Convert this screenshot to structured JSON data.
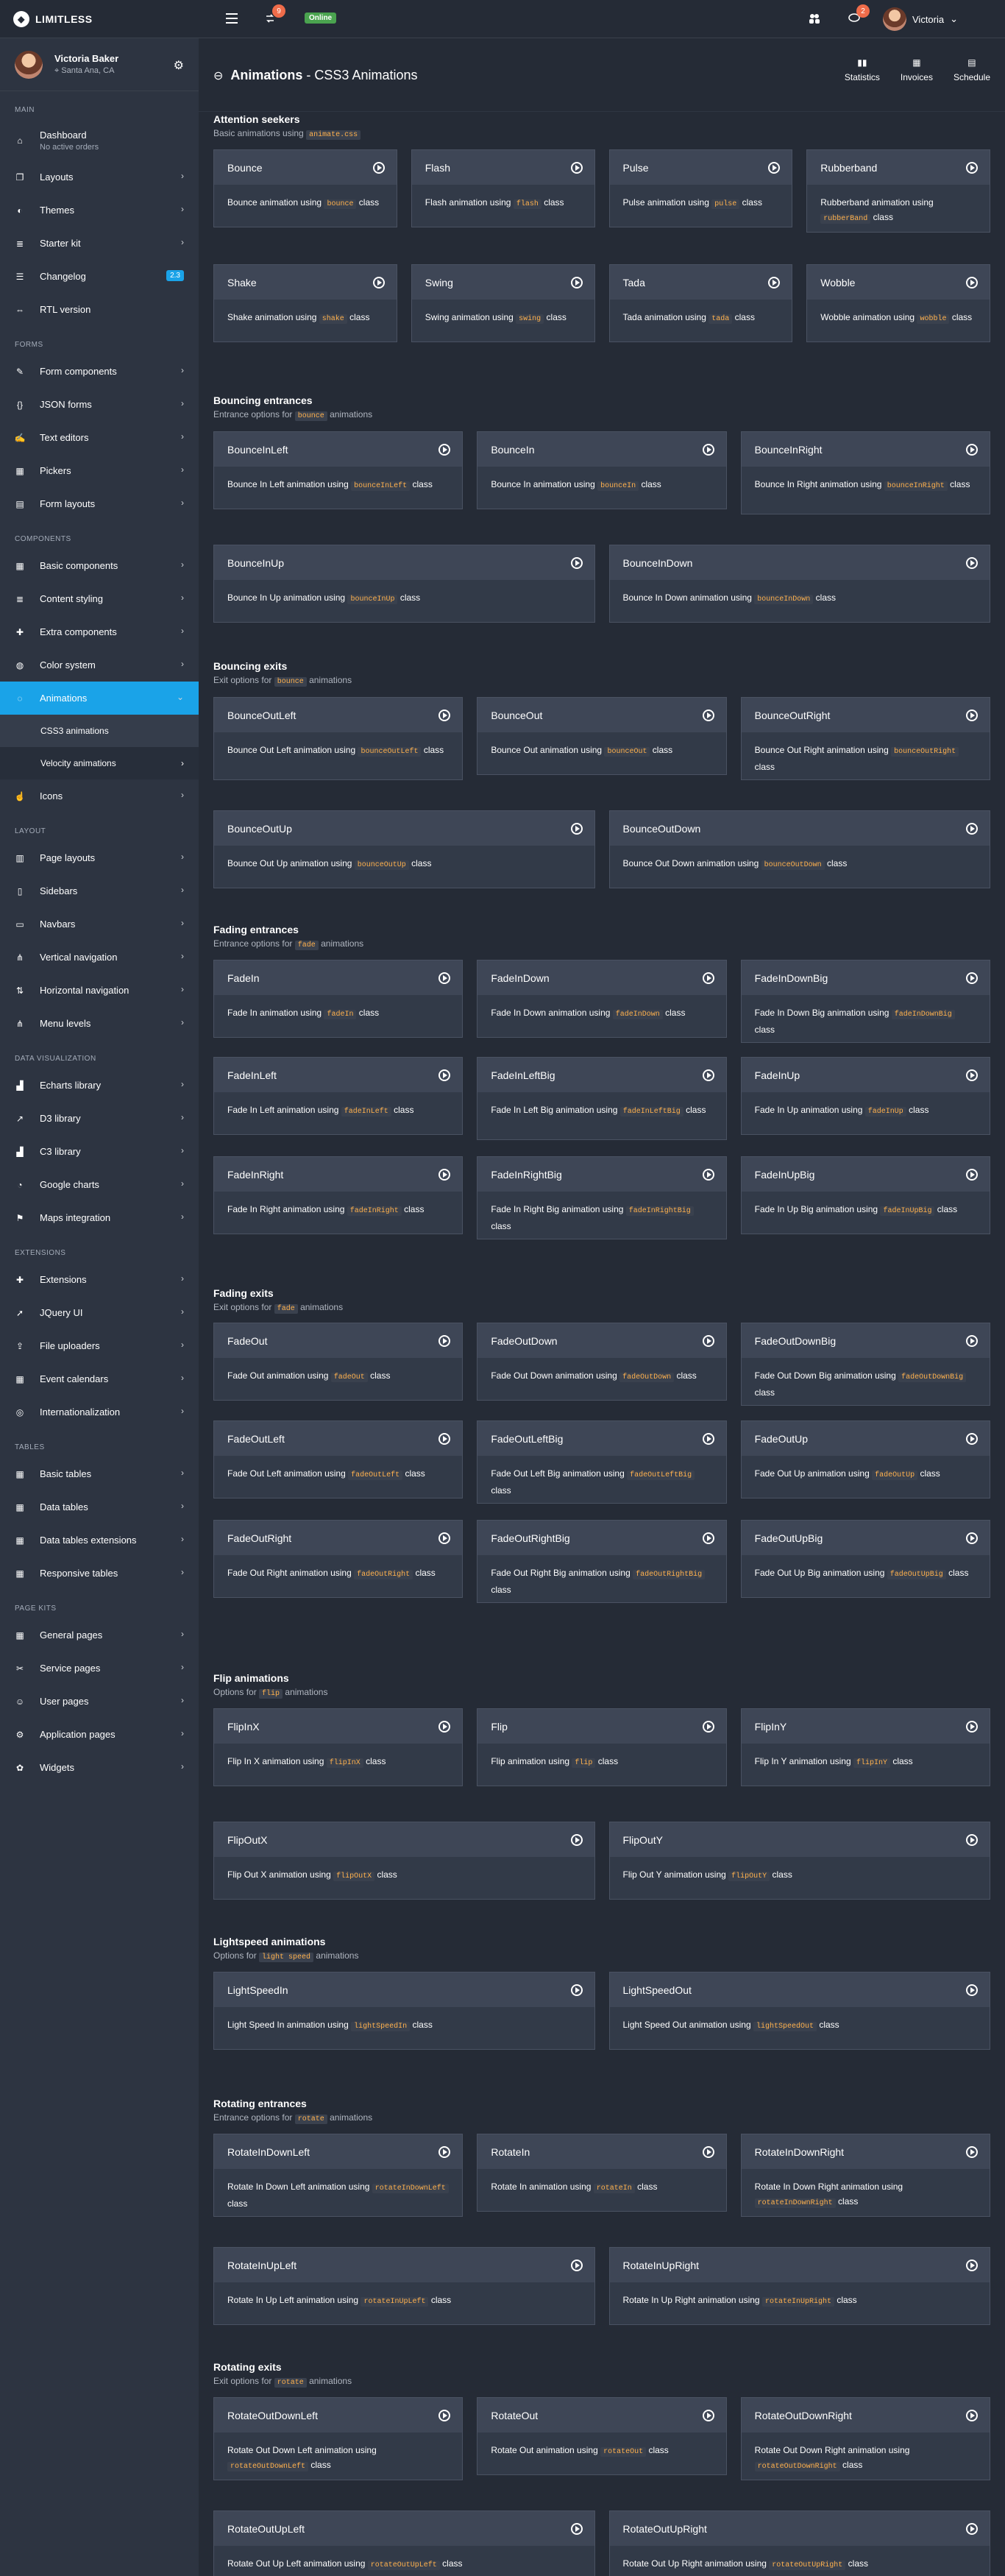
{
  "app": {
    "brand": "LIMITLESS",
    "online_label": "Online",
    "badge_sync": "9",
    "badge_msgs": "2",
    "user_name": "Victoria"
  },
  "sidebar": {
    "user_name": "Victoria Baker",
    "user_location": "Santa Ana, CA",
    "groups": [
      {
        "title": "MAIN",
        "items": [
          {
            "label": "Dashboard",
            "desc": "No active orders",
            "icon": "home-icon"
          },
          {
            "label": "Layouts",
            "icon": "copy-icon",
            "chev": true
          },
          {
            "label": "Themes",
            "icon": "palette-icon",
            "chev": true
          },
          {
            "label": "Starter kit",
            "icon": "stack-icon",
            "chev": true
          },
          {
            "label": "Changelog",
            "icon": "list-icon",
            "badge": "2.3"
          },
          {
            "label": "RTL version",
            "icon": "width-icon"
          }
        ]
      },
      {
        "title": "FORMS",
        "items": [
          {
            "label": "Form components",
            "icon": "pencil-icon",
            "chev": true
          },
          {
            "label": "JSON forms",
            "icon": "braces-icon",
            "chev": true
          },
          {
            "label": "Text editors",
            "icon": "edit-icon",
            "chev": true
          },
          {
            "label": "Pickers",
            "icon": "calendar-icon",
            "chev": true
          },
          {
            "label": "Form layouts",
            "icon": "form-icon",
            "chev": true
          }
        ]
      },
      {
        "title": "COMPONENTS",
        "items": [
          {
            "label": "Basic components",
            "icon": "grid-icon",
            "chev": true
          },
          {
            "label": "Content styling",
            "icon": "stack-icon",
            "chev": true
          },
          {
            "label": "Extra components",
            "icon": "puzzle-icon",
            "chev": true
          },
          {
            "label": "Color system",
            "icon": "drop-icon",
            "chev": true
          },
          {
            "label": "Animations",
            "icon": "spinner-icon",
            "chev": true,
            "active": true,
            "subs": [
              "CSS3 animations",
              "Velocity animations"
            ]
          },
          {
            "label": "Icons",
            "icon": "thumbs-up-icon",
            "chev": true
          }
        ]
      },
      {
        "title": "LAYOUT",
        "items": [
          {
            "label": "Page layouts",
            "icon": "layout-icon",
            "chev": true
          },
          {
            "label": "Sidebars",
            "icon": "sidebar-icon",
            "chev": true
          },
          {
            "label": "Navbars",
            "icon": "navbar-icon",
            "chev": true
          },
          {
            "label": "Vertical navigation",
            "icon": "tree-icon",
            "chev": true
          },
          {
            "label": "Horizontal navigation",
            "icon": "sort-icon",
            "chev": true
          },
          {
            "label": "Menu levels",
            "icon": "tree-icon",
            "chev": true
          }
        ]
      },
      {
        "title": "DATA VISUALIZATION",
        "items": [
          {
            "label": "Echarts library",
            "icon": "chart-icon",
            "chev": true
          },
          {
            "label": "D3 library",
            "icon": "chart-line-icon",
            "chev": true
          },
          {
            "label": "C3 library",
            "icon": "chart-icon",
            "chev": true
          },
          {
            "label": "Google charts",
            "icon": "pie-icon",
            "chev": true
          },
          {
            "label": "Maps integration",
            "icon": "map-icon",
            "chev": true
          }
        ]
      },
      {
        "title": "EXTENSIONS",
        "items": [
          {
            "label": "Extensions",
            "icon": "puzzle-icon",
            "chev": true
          },
          {
            "label": "JQuery UI",
            "icon": "cursor-icon",
            "chev": true
          },
          {
            "label": "File uploaders",
            "icon": "upload-icon",
            "chev": true
          },
          {
            "label": "Event calendars",
            "icon": "calendar-icon",
            "chev": true
          },
          {
            "label": "Internationalization",
            "icon": "globe-icon",
            "chev": true
          }
        ]
      },
      {
        "title": "TABLES",
        "items": [
          {
            "label": "Basic tables",
            "icon": "table-icon",
            "chev": true
          },
          {
            "label": "Data tables",
            "icon": "table-icon",
            "chev": true
          },
          {
            "label": "Data tables extensions",
            "icon": "table-icon",
            "chev": true
          },
          {
            "label": "Responsive tables",
            "icon": "table-icon",
            "chev": true
          }
        ]
      },
      {
        "title": "PAGE KITS",
        "items": [
          {
            "label": "General pages",
            "icon": "grid-icon",
            "chev": true
          },
          {
            "label": "Service pages",
            "icon": "tools-icon",
            "chev": true
          },
          {
            "label": "User pages",
            "icon": "users-icon",
            "chev": true
          },
          {
            "label": "Application pages",
            "icon": "gear-icon",
            "chev": true
          },
          {
            "label": "Widgets",
            "icon": "widget-icon",
            "chev": true
          }
        ]
      }
    ]
  },
  "header": {
    "title_bold": "Animations",
    "title_rest": " - CSS3 Animations",
    "buttons": [
      "Statistics",
      "Invoices",
      "Schedule"
    ]
  },
  "sections": [
    {
      "title": "Attention seekers",
      "sub_pre": "Basic animations using",
      "sub_code": "animate.css",
      "sub_post": "",
      "cols": 4,
      "rows": [
        [
          {
            "name": "Bounce",
            "pre": "Bounce animation using",
            "code": "bounce",
            "post": "class"
          },
          {
            "name": "Flash",
            "pre": "Flash animation using",
            "code": "flash",
            "post": "class"
          },
          {
            "name": "Pulse",
            "pre": "Pulse animation using",
            "code": "pulse",
            "post": "class"
          },
          {
            "name": "Rubberband",
            "pre": "Rubberband animation using",
            "code": "rubberBand",
            "post": "class"
          }
        ],
        [
          {
            "name": "Shake",
            "pre": "Shake animation using",
            "code": "shake",
            "post": "class"
          },
          {
            "name": "Swing",
            "pre": "Swing animation using",
            "code": "swing",
            "post": "class"
          },
          {
            "name": "Tada",
            "pre": "Tada animation using",
            "code": "tada",
            "post": "class"
          },
          {
            "name": "Wobble",
            "pre": "Wobble animation using",
            "code": "wobble",
            "post": "class"
          }
        ]
      ]
    },
    {
      "title": "Bouncing entrances",
      "sub_pre": "Entrance options for",
      "sub_code": "bounce",
      "sub_post": "animations",
      "cols": 3,
      "rows": [
        [
          {
            "name": "BounceInLeft",
            "pre": "Bounce In Left animation using",
            "code": "bounceInLeft",
            "post": "class"
          },
          {
            "name": "BounceIn",
            "pre": "Bounce In animation using",
            "code": "bounceIn",
            "post": "class"
          },
          {
            "name": "BounceInRight",
            "pre": "Bounce In Right animation using",
            "code": "bounceInRight",
            "post": "class"
          }
        ],
        [
          {
            "name": "BounceInUp",
            "pre": "Bounce In Up animation using",
            "code": "bounceInUp",
            "post": "class"
          },
          {
            "name": "BounceInDown",
            "pre": "Bounce In Down animation using",
            "code": "bounceInDown",
            "post": "class"
          }
        ]
      ]
    },
    {
      "title": "Bouncing exits",
      "sub_pre": "Exit options for",
      "sub_code": "bounce",
      "sub_post": "animations",
      "cols": 3,
      "rows": [
        [
          {
            "name": "BounceOutLeft",
            "pre": "Bounce Out Left animation using",
            "code": "bounceOutLeft",
            "post": "class"
          },
          {
            "name": "BounceOut",
            "pre": "Bounce Out animation using",
            "code": "bounceOut",
            "post": "class"
          },
          {
            "name": "BounceOutRight",
            "pre": "Bounce Out Right animation using",
            "code": "bounceOutRight",
            "post": "class"
          }
        ],
        [
          {
            "name": "BounceOutUp",
            "pre": "Bounce Out Up animation using",
            "code": "bounceOutUp",
            "post": "class"
          },
          {
            "name": "BounceOutDown",
            "pre": "Bounce Out Down animation using",
            "code": "bounceOutDown",
            "post": "class"
          }
        ]
      ]
    },
    {
      "title": "Fading entrances",
      "sub_pre": "Entrance options for",
      "sub_code": "fade",
      "sub_post": "animations",
      "cols": 3,
      "rows": [
        [
          {
            "name": "FadeIn",
            "pre": "Fade In animation using",
            "code": "fadeIn",
            "post": "class"
          },
          {
            "name": "FadeInDown",
            "pre": "Fade In Down animation using",
            "code": "fadeInDown",
            "post": "class"
          },
          {
            "name": "FadeInDownBig",
            "pre": "Fade In Down Big animation using",
            "code": "fadeInDownBig",
            "post": "class"
          }
        ],
        [
          {
            "name": "FadeInLeft",
            "pre": "Fade In Left animation using",
            "code": "fadeInLeft",
            "post": "class"
          },
          {
            "name": "FadeInLeftBig",
            "pre": "Fade In Left Big animation using",
            "code": "fadeInLeftBig",
            "post": "class"
          },
          {
            "name": "FadeInUp",
            "pre": "Fade In Up animation using",
            "code": "fadeInUp",
            "post": "class"
          }
        ],
        [
          {
            "name": "FadeInRight",
            "pre": "Fade In Right animation using",
            "code": "fadeInRight",
            "post": "class"
          },
          {
            "name": "FadeInRightBig",
            "pre": "Fade In Right Big animation using",
            "code": "fadeInRightBig",
            "post": "class"
          },
          {
            "name": "FadeInUpBig",
            "pre": "Fade In Up Big animation using",
            "code": "fadeInUpBig",
            "post": "class"
          }
        ]
      ]
    },
    {
      "title": "Fading exits",
      "sub_pre": "Exit options for",
      "sub_code": "fade",
      "sub_post": "animations",
      "cols": 3,
      "rows": [
        [
          {
            "name": "FadeOut",
            "pre": "Fade Out animation using",
            "code": "fadeOut",
            "post": "class"
          },
          {
            "name": "FadeOutDown",
            "pre": "Fade Out Down animation using",
            "code": "fadeOutDown",
            "post": "class"
          },
          {
            "name": "FadeOutDownBig",
            "pre": "Fade Out Down Big animation using",
            "code": "fadeOutDownBig",
            "post": "class"
          }
        ],
        [
          {
            "name": "FadeOutLeft",
            "pre": "Fade Out Left animation using",
            "code": "fadeOutLeft",
            "post": "class"
          },
          {
            "name": "FadeOutLeftBig",
            "pre": "Fade Out Left Big animation using",
            "code": "fadeOutLeftBig",
            "post": "class"
          },
          {
            "name": "FadeOutUp",
            "pre": "Fade Out Up animation using",
            "code": "fadeOutUp",
            "post": "class"
          }
        ],
        [
          {
            "name": "FadeOutRight",
            "pre": "Fade Out Right animation using",
            "code": "fadeOutRight",
            "post": "class"
          },
          {
            "name": "FadeOutRightBig",
            "pre": "Fade Out Right Big animation using",
            "code": "fadeOutRightBig",
            "post": "class"
          },
          {
            "name": "FadeOutUpBig",
            "pre": "Fade Out Up Big animation using",
            "code": "fadeOutUpBig",
            "post": "class"
          }
        ]
      ]
    },
    {
      "title": "Flip animations",
      "sub_pre": "Options for",
      "sub_code": "flip",
      "sub_post": "animations",
      "cols": 3,
      "rows": [
        [
          {
            "name": "FlipInX",
            "pre": "Flip In X animation using",
            "code": "flipInX",
            "post": "class"
          },
          {
            "name": "Flip",
            "pre": "Flip animation using",
            "code": "flip",
            "post": "class"
          },
          {
            "name": "FlipInY",
            "pre": "Flip In Y animation using",
            "code": "flipInY",
            "post": "class"
          }
        ],
        [
          {
            "name": "FlipOutX",
            "pre": "Flip Out X animation using",
            "code": "flipOutX",
            "post": "class"
          },
          {
            "name": "FlipOutY",
            "pre": "Flip Out Y animation using",
            "code": "flipOutY",
            "post": "class"
          }
        ]
      ]
    },
    {
      "title": "Lightspeed animations",
      "sub_pre": "Options for",
      "sub_code": "light speed",
      "sub_post": "animations",
      "cols": 2,
      "rows": [
        [
          {
            "name": "LightSpeedIn",
            "pre": "Light Speed In animation using",
            "code": "lightSpeedIn",
            "post": "class"
          },
          {
            "name": "LightSpeedOut",
            "pre": "Light Speed Out animation using",
            "code": "lightSpeedOut",
            "post": "class"
          }
        ]
      ]
    },
    {
      "title": "Rotating entrances",
      "sub_pre": "Entrance options for",
      "sub_code": "rotate",
      "sub_post": "animations",
      "cols": 3,
      "rows": [
        [
          {
            "name": "RotateInDownLeft",
            "pre": "Rotate In Down Left animation using",
            "code": "rotateInDownLeft",
            "post": "class"
          },
          {
            "name": "RotateIn",
            "pre": "Rotate In animation using",
            "code": "rotateIn",
            "post": "class"
          },
          {
            "name": "RotateInDownRight",
            "pre": "Rotate In Down Right animation using",
            "code": "rotateInDownRight",
            "post": "class"
          }
        ],
        [
          {
            "name": "RotateInUpLeft",
            "pre": "Rotate In Up Left animation using",
            "code": "rotateInUpLeft",
            "post": "class"
          },
          {
            "name": "RotateInUpRight",
            "pre": "Rotate In Up Right animation using",
            "code": "rotateInUpRight",
            "post": "class"
          }
        ]
      ]
    },
    {
      "title": "Rotating exits",
      "sub_pre": "Exit options for",
      "sub_code": "rotate",
      "sub_post": "animations",
      "cols": 3,
      "rows": [
        [
          {
            "name": "RotateOutDownLeft",
            "pre": "Rotate Out Down Left animation using",
            "code": "rotateOutDownLeft",
            "post": "class"
          },
          {
            "name": "RotateOut",
            "pre": "Rotate Out animation using",
            "code": "rotateOut",
            "post": "class"
          },
          {
            "name": "RotateOutDownRight",
            "pre": "Rotate Out Down Right animation using",
            "code": "rotateOutDownRight",
            "post": "class"
          }
        ],
        [
          {
            "name": "RotateOutUpLeft",
            "pre": "Rotate Out Up Left animation using",
            "code": "rotateOutUpLeft",
            "post": "class"
          },
          {
            "name": "RotateOutUpRight",
            "pre": "Rotate Out Up Right animation using",
            "code": "rotateOutUpRight",
            "post": "class"
          }
        ]
      ]
    }
  ]
}
